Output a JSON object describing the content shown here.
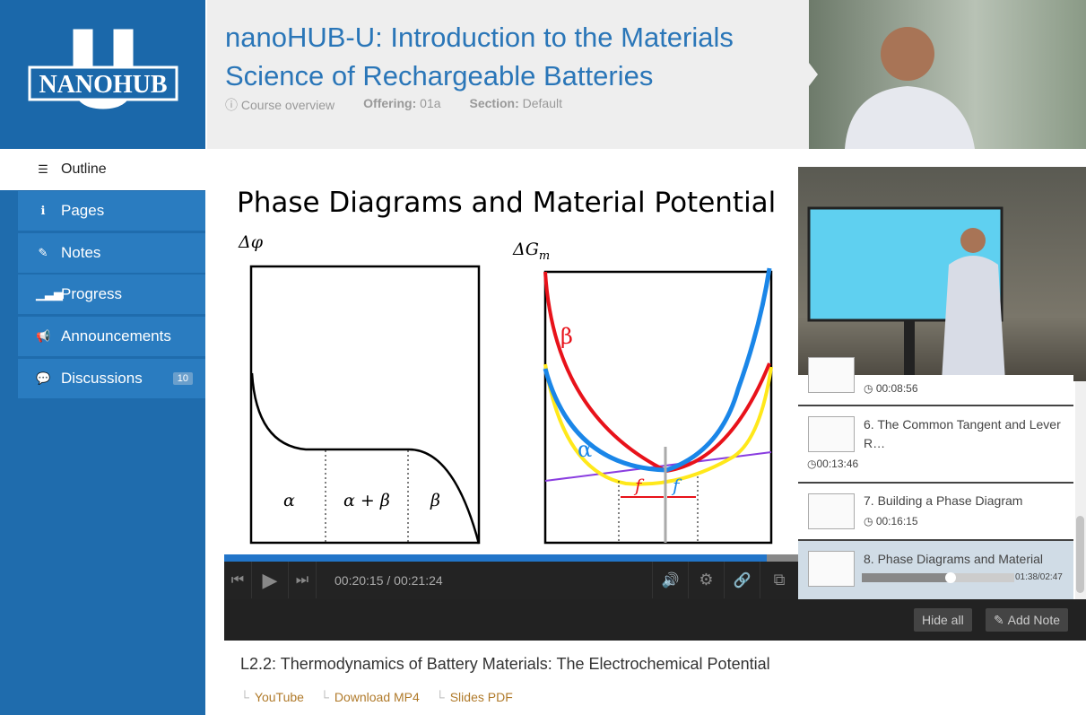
{
  "logo": {
    "text": "NANOHUB",
    "letter": "U"
  },
  "header": {
    "title": "nanoHUB-U: Introduction to the Materials Science of Rechargeable Batteries",
    "overview": "Course overview",
    "offering_label": "Offering:",
    "offering": "01a",
    "section_label": "Section:",
    "section": "Default"
  },
  "nav": [
    {
      "label": "Outline",
      "icon": "list-icon"
    },
    {
      "label": "Pages",
      "icon": "info-icon"
    },
    {
      "label": "Notes",
      "icon": "edit-icon"
    },
    {
      "label": "Progress",
      "icon": "signal-icon"
    },
    {
      "label": "Announcements",
      "icon": "megaphone-icon"
    },
    {
      "label": "Discussions",
      "icon": "chat-icon",
      "badge": "10"
    }
  ],
  "slide": {
    "title": "Phase Diagrams and Material Potential",
    "left_axis": "Δφ",
    "right_axis": "ΔG",
    "right_axis_sub": "m",
    "alpha": "α",
    "alpha_beta": "α + β",
    "beta": "β",
    "f_beta": "f",
    "f_alpha": "f"
  },
  "player": {
    "time": "00:20:15 / 00:21:24",
    "progress": 0.945
  },
  "playlist": [
    {
      "time": "00:08:56"
    },
    {
      "title": "6. The Common Tangent and Lever R…",
      "time": "00:13:46"
    },
    {
      "title": "7. Building a Phase Diagram",
      "time": "00:16:15"
    },
    {
      "title": "8. Phase Diagrams and Material",
      "time": "01:38/02:47",
      "progress": 0.59,
      "active": true
    }
  ],
  "buttons": {
    "hide_all": "Hide all",
    "add_note": "Add Note"
  },
  "lecture": {
    "title": "L2.2: Thermodynamics of Battery Materials: The Electrochemical Potential",
    "links": [
      "YouTube",
      "Download MP4",
      "Slides PDF"
    ]
  },
  "colors": {
    "sidebar": "#1f6cad",
    "accent": "#2275c9",
    "link": "#b07a2a"
  }
}
